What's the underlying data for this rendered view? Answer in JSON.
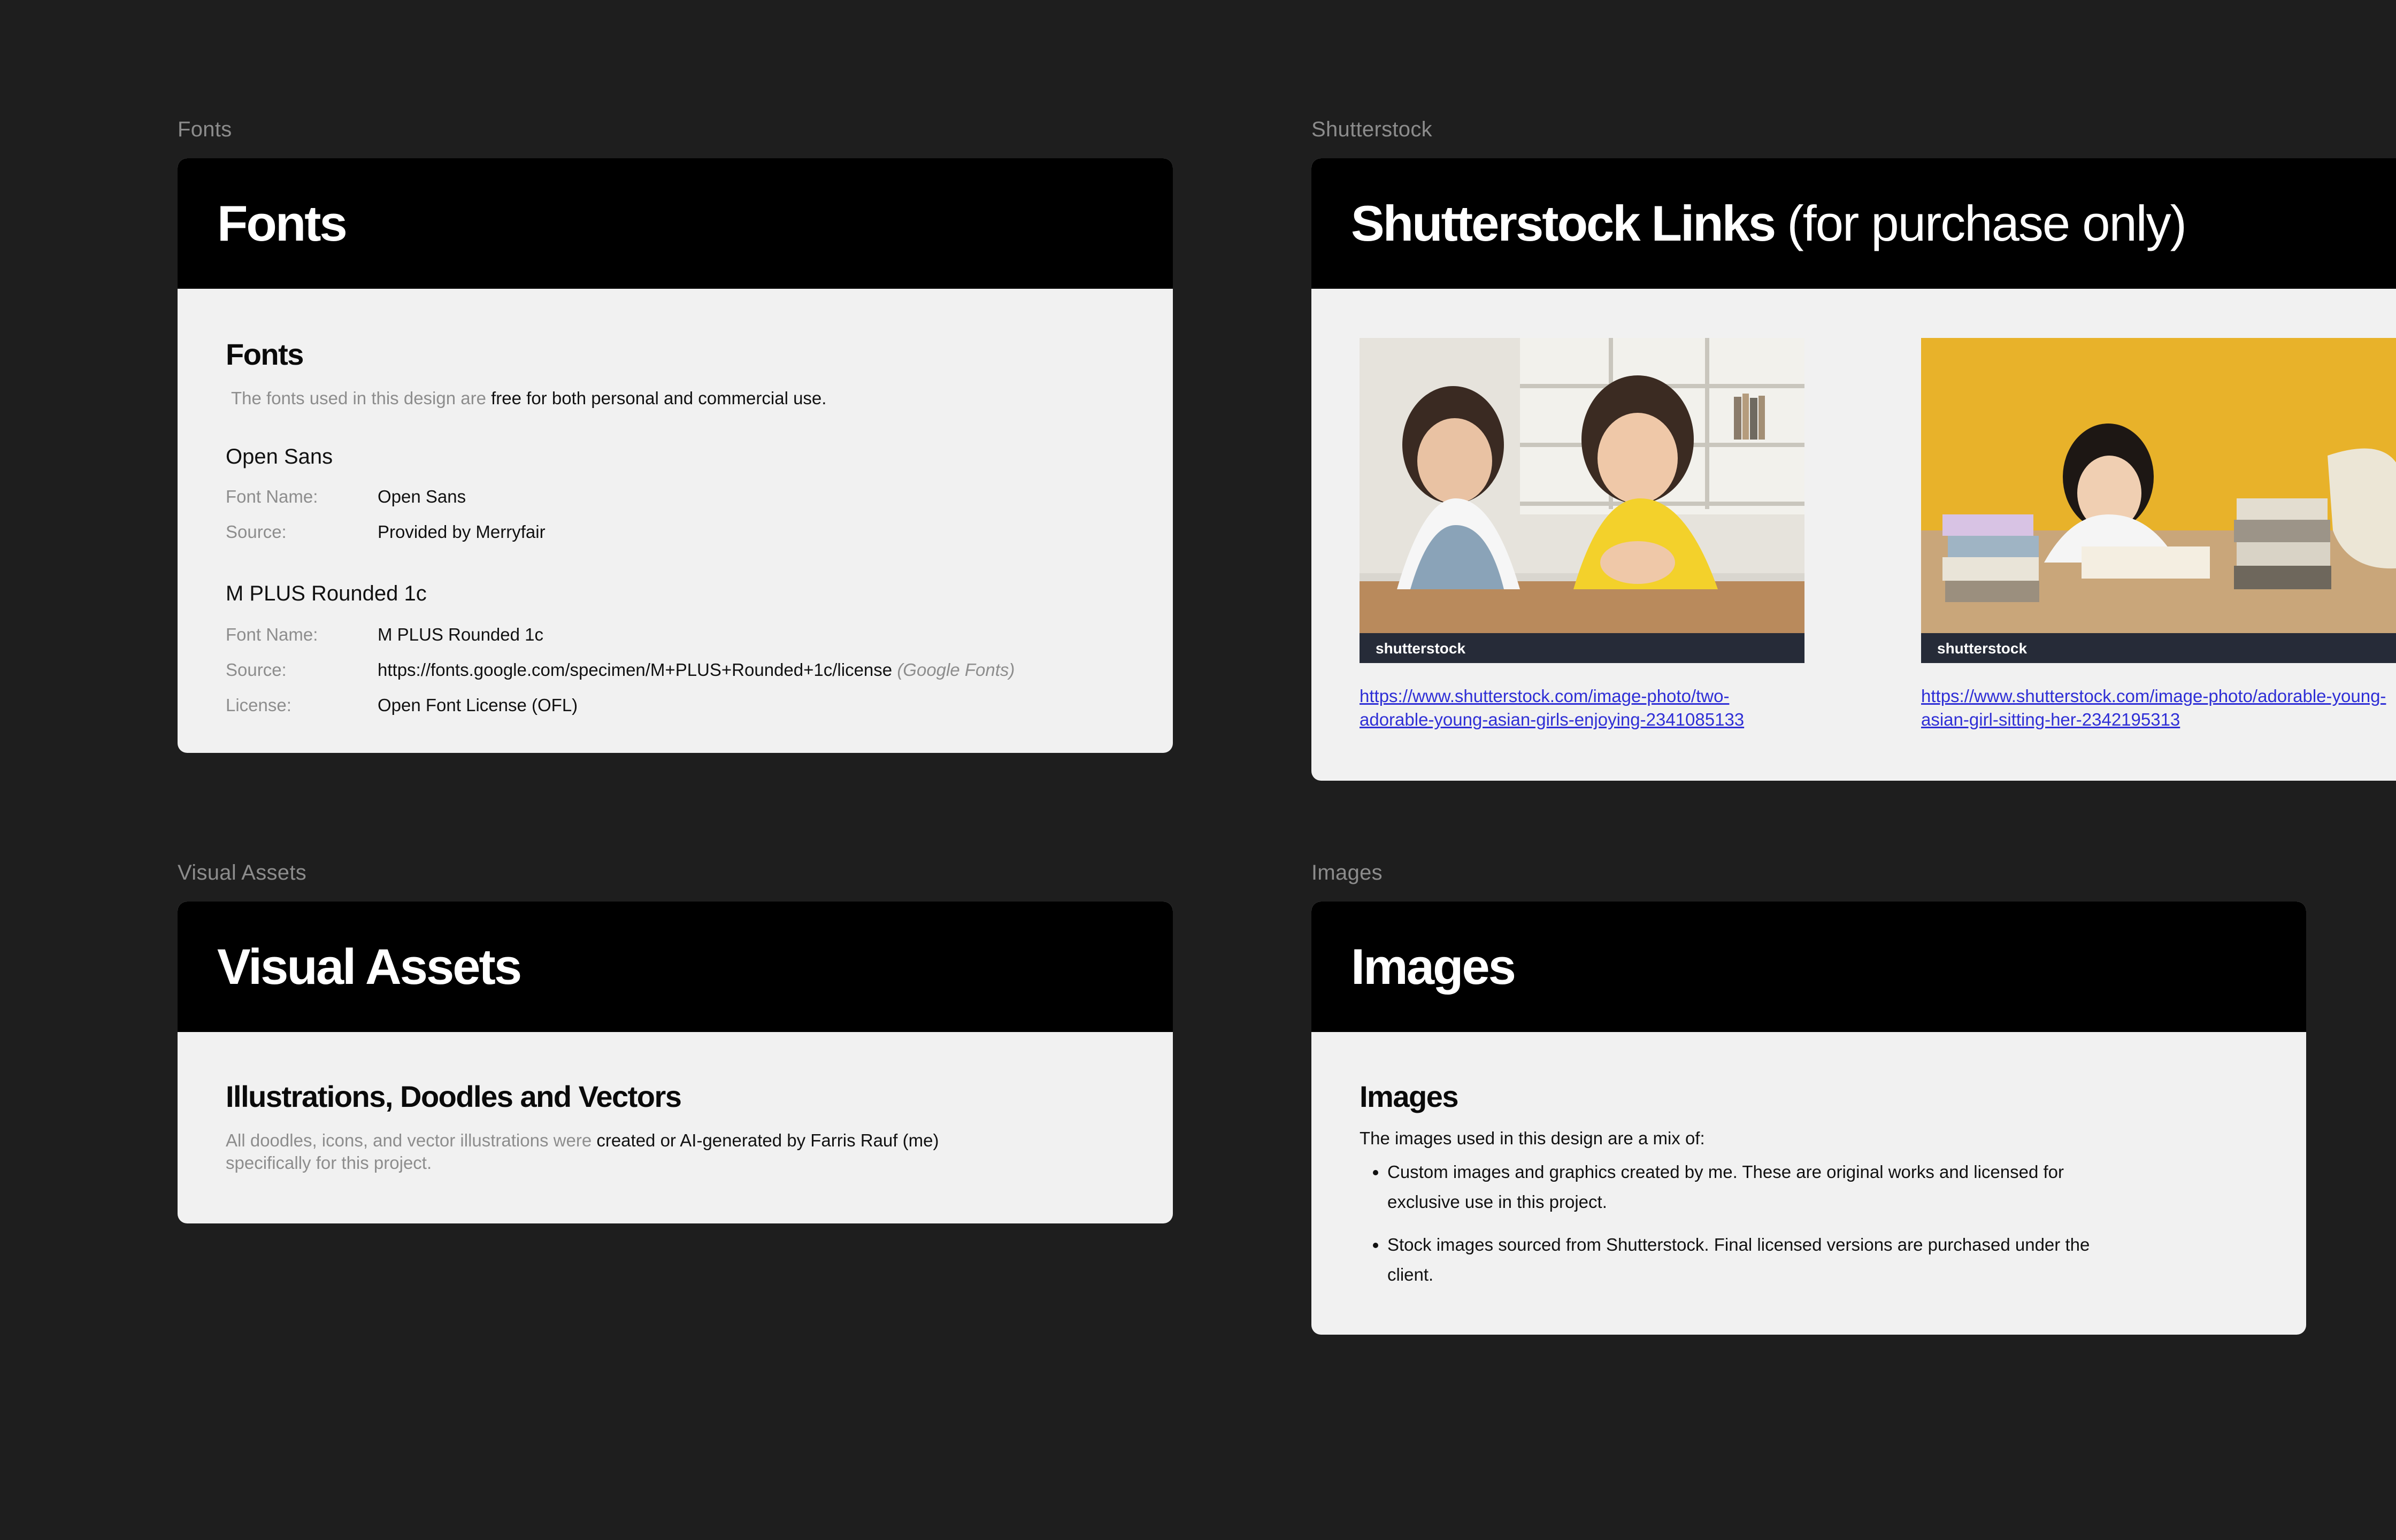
{
  "fonts_section": {
    "frame_label": "Fonts",
    "title": "Fonts",
    "heading": "Fonts",
    "intro_muted": "The fonts used in this design are",
    "intro_dark": "free for both personal and commercial use.",
    "font1": {
      "name": "Open Sans",
      "key_name": "Font Name:",
      "val_name": "Open Sans",
      "key_source": "Source:",
      "val_source": "Provided by Merryfair"
    },
    "font2": {
      "name": "M PLUS Rounded 1c",
      "key_name": "Font Name:",
      "val_name": "M PLUS Rounded 1c",
      "key_source": "Source:",
      "val_source": "https://fonts.google.com/specimen/M+PLUS+Rounded+1c/license",
      "val_source_note": "(Google Fonts)",
      "key_license": "License:",
      "val_license": "Open Font License (OFL)"
    }
  },
  "shutterstock_section": {
    "frame_label": "Shutterstock",
    "title_bold": "Shutterstock Links",
    "title_light": "(for purchase only)",
    "image1": {
      "brand": "shutterstock",
      "link_line1": "https://www.shutterstock.com/image-photo/two-",
      "link_line2": "adorable-young-asian-girls-enjoying-2341085133"
    },
    "image2": {
      "brand": "shutterstock",
      "link_line1": "https://www.shutterstock.com/image-photo/adorable-young-",
      "link_line2": "asian-girl-sitting-her-2342195313"
    }
  },
  "visual_assets_section": {
    "frame_label": "Visual Assets",
    "title": "Visual Assets",
    "heading": "Illustrations, Doodles and Vectors",
    "text_muted": "All doodles, icons, and vector illustrations were",
    "text_dark": "created or AI-generated by Farris Rauf (me)",
    "text_muted2": "specifically for this project."
  },
  "images_section": {
    "frame_label": "Images",
    "title": "Images",
    "heading": "Images",
    "intro": "The images used in this design are a mix of:",
    "bullets": [
      "Custom images and graphics created by me. These are original works and licensed for exclusive use in this project.",
      "Stock images sourced from Shutterstock. Final licensed versions are purchased under the client."
    ]
  },
  "colors": {
    "canvas": "#1e1e1e",
    "card": "#f1f1f1",
    "header": "#000000",
    "link": "#2f2fd6",
    "muted": "#8d8d8d"
  }
}
